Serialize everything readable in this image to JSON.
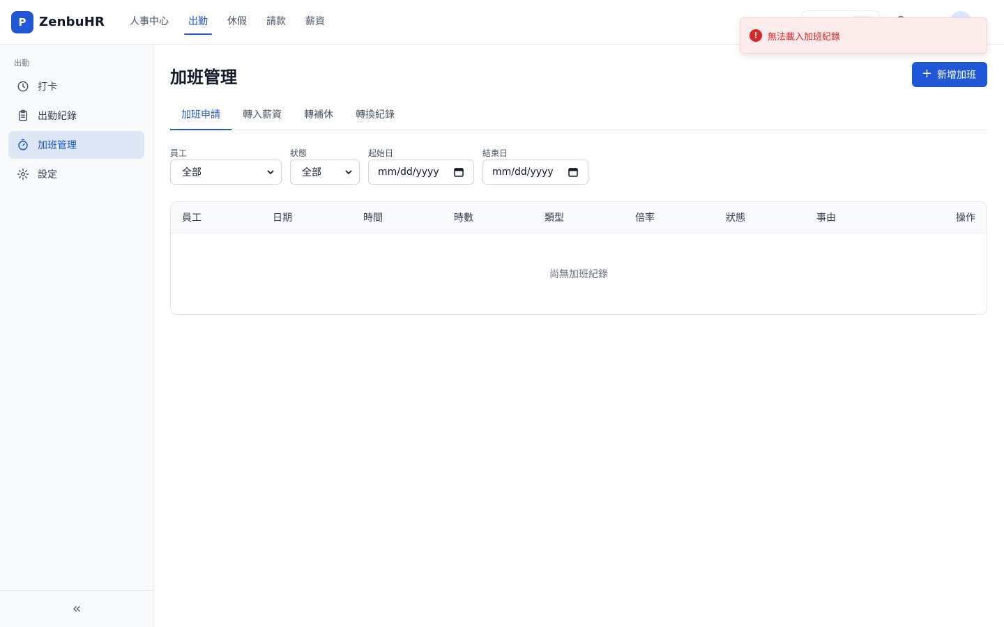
{
  "brand": {
    "logo_letter": "P",
    "name": "ZenbuHR"
  },
  "topnav": [
    {
      "label": "人事中心",
      "active": false
    },
    {
      "label": "出勤",
      "active": true
    },
    {
      "label": "休假",
      "active": false
    },
    {
      "label": "請款",
      "active": false
    },
    {
      "label": "薪資",
      "active": false
    }
  ],
  "toast": {
    "message": "無法載入加班紀錄",
    "type": "error",
    "icon": "error-icon"
  },
  "sidebar": {
    "section_title": "出勤",
    "items": [
      {
        "label": "打卡",
        "icon": "clock-icon",
        "active": false
      },
      {
        "label": "出勤紀錄",
        "icon": "clipboard-icon",
        "active": false
      },
      {
        "label": "加班管理",
        "icon": "timer-icon",
        "active": true
      },
      {
        "label": "設定",
        "icon": "gear-icon",
        "active": false
      }
    ],
    "collapse_icon": "chevrons-left-icon"
  },
  "page": {
    "title": "加班管理",
    "add_button_label": "新增加班"
  },
  "tabs": [
    {
      "label": "加班申請",
      "active": true
    },
    {
      "label": "轉入薪資",
      "active": false
    },
    {
      "label": "轉補休",
      "active": false
    },
    {
      "label": "轉換紀錄",
      "active": false
    }
  ],
  "filters": {
    "employee": {
      "label": "員工",
      "value": "全部"
    },
    "status": {
      "label": "狀態",
      "value": "全部"
    },
    "start_date": {
      "label": "起始日",
      "placeholder": "mm/dd/yyyy"
    },
    "end_date": {
      "label": "結束日",
      "placeholder": "mm/dd/yyyy"
    }
  },
  "table": {
    "columns": [
      "員工",
      "日期",
      "時間",
      "時數",
      "類型",
      "倍率",
      "狀態",
      "事由",
      "操作"
    ],
    "empty_text": "尚無加班紀錄"
  },
  "colors": {
    "primary": "#1f57d6",
    "error": "#dc2626",
    "toast_bg": "#fdecec",
    "sidebar_active_bg": "#dde7f6"
  }
}
